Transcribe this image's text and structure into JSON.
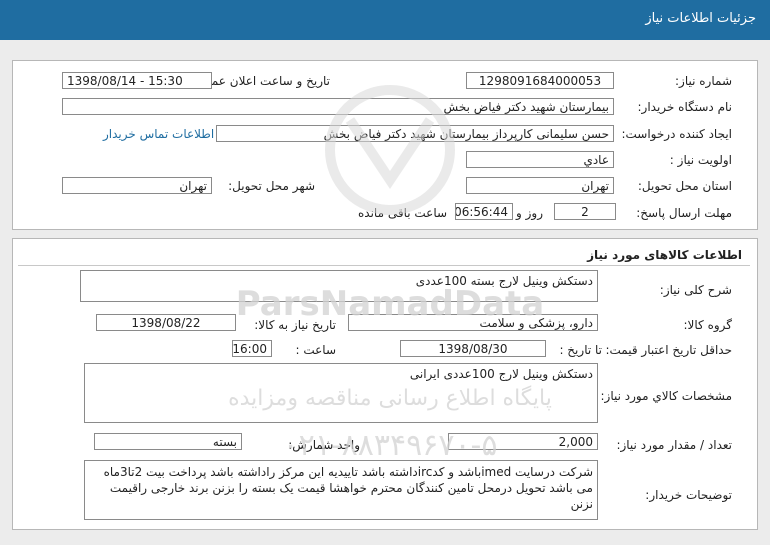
{
  "header": {
    "title": "جزئیات اطلاعات نیاز"
  },
  "info": {
    "need_number_label": "شماره نیاز:",
    "need_number": "1298091684000053",
    "announce_label": "تاریخ و ساعت اعلان عمومی:",
    "announce_value": "1398/08/14 - 15:30",
    "buyer_label": "نام دستگاه خریدار:",
    "buyer_value": "بیمارستان شهید دکتر فیاض بخش",
    "creator_label": "ایجاد کننده درخواست:",
    "creator_value": "حسن سلیمانی کارپرداز بیمارستان شهید دکتر فیاض بخش",
    "contact_link": "اطلاعات تماس خریدار",
    "priority_label": "اولویت نیاز :",
    "priority_value": "عادي",
    "province_label": "استان محل تحویل:",
    "province_value": "تهران",
    "city_label": "شهر محل تحویل:",
    "city_value": "تهران",
    "deadline_label": "مهلت ارسال پاسخ:",
    "days_value": "2",
    "days_text": "روز و",
    "time_value": "06:56:44",
    "remaining_text": "ساعت باقی مانده"
  },
  "goods": {
    "section_title": "اطلاعات کالاهای مورد نیاز",
    "desc_label": "شرح کلی نیاز:",
    "desc_value": "دستکش وینیل لارج  بسته 100عددی",
    "group_label": "گروه کالا:",
    "group_value": "دارو، پزشکی و سلامت",
    "need_date_label": "تاریخ نیاز به کالا:",
    "need_date_value": "1398/08/22",
    "min_validity_label": "حداقل تاریخ اعتبار قیمت:",
    "until_date_label": "تا تاریخ :",
    "until_date_value": "1398/08/30",
    "time_label": "ساعت :",
    "time_value": "16:00",
    "specs_label": "مشخصات کالاي مورد نیاز:",
    "specs_value": "دستکش وینیل لارج 100عددی  ایرانی",
    "qty_label": "تعداد / مقدار مورد نیاز:",
    "qty_value": "2,000",
    "unit_label": "واحد شمارش:",
    "unit_value": "بسته",
    "notes_label": "توضیحات خریدار:",
    "notes_value": "شرکت درسایت imedباشد و کدircداشته باشد تاییدیه این مرکز راداشته باشد پرداخت بیت 2تا3ماه می باشد تحویل درمحل تامین کنندگان محترم خواهشا قیمت یک بسته را بزنن برند خارجی راقیمت نزنن"
  },
  "watermark": {
    "brand": "ParsNamadData",
    "tagline": "پایگاه اطلاع رسانی مناقصه ومزایده",
    "phone": "۰۲۱-۸۸۳۴۹۶۷۰-۵"
  }
}
